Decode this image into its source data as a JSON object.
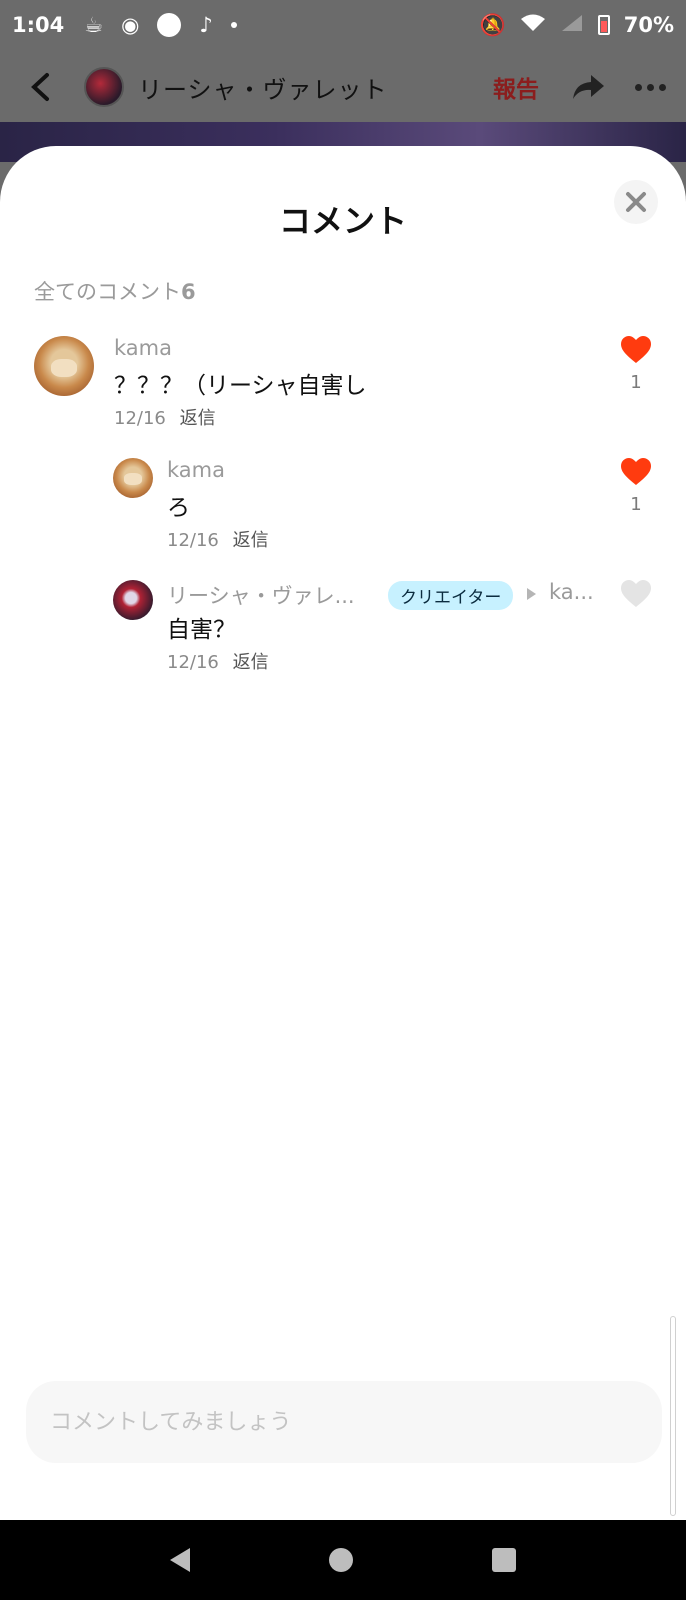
{
  "status_bar": {
    "time": "1:04",
    "battery": "70%"
  },
  "app_bar": {
    "title": "リーシャ・ヴァレット",
    "report_label": "報告"
  },
  "sheet": {
    "title": "コメント",
    "count_label": "全てのコメント",
    "count": "6"
  },
  "comments": [
    {
      "author": "kama",
      "text": "？？？（リーシャ自害し",
      "date": "12/16",
      "reply_label": "返信",
      "likes": "1",
      "liked": true
    },
    {
      "author": "kama",
      "text": "ろ",
      "date": "12/16",
      "reply_label": "返信",
      "likes": "1",
      "liked": true
    },
    {
      "author": "リーシャ・ヴァレ...",
      "badge": "クリエイター",
      "reply_to": "ka...",
      "text": "自害？",
      "date": "12/16",
      "reply_label": "返信",
      "likes": "",
      "liked": false
    }
  ],
  "input": {
    "placeholder": "コメントしてみましょう"
  },
  "colors": {
    "like_active": "#ff3b0f",
    "like_inactive": "#e4e4e4",
    "report": "#8b1d1d",
    "badge_bg": "#c7f1ff"
  }
}
